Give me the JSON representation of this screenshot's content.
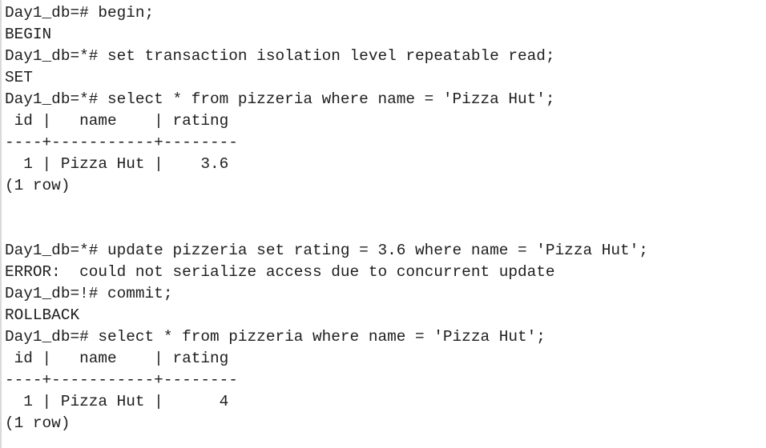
{
  "terminal": {
    "lines": [
      "Day1_db=# begin;",
      "BEGIN",
      "Day1_db=*# set transaction isolation level repeatable read;",
      "SET",
      "Day1_db=*# select * from pizzeria where name = 'Pizza Hut';",
      " id |   name    | rating",
      "----+-----------+--------",
      "  1 | Pizza Hut |    3.6",
      "(1 row)",
      "",
      "",
      "Day1_db=*# update pizzeria set rating = 3.6 where name = 'Pizza Hut';",
      "ERROR:  could not serialize access due to concurrent update",
      "Day1_db=!# commit;",
      "ROLLBACK",
      "Day1_db=# select * from pizzeria where name = 'Pizza Hut';",
      " id |   name    | rating",
      "----+-----------+--------",
      "  1 | Pizza Hut |      4",
      "(1 row)"
    ]
  }
}
